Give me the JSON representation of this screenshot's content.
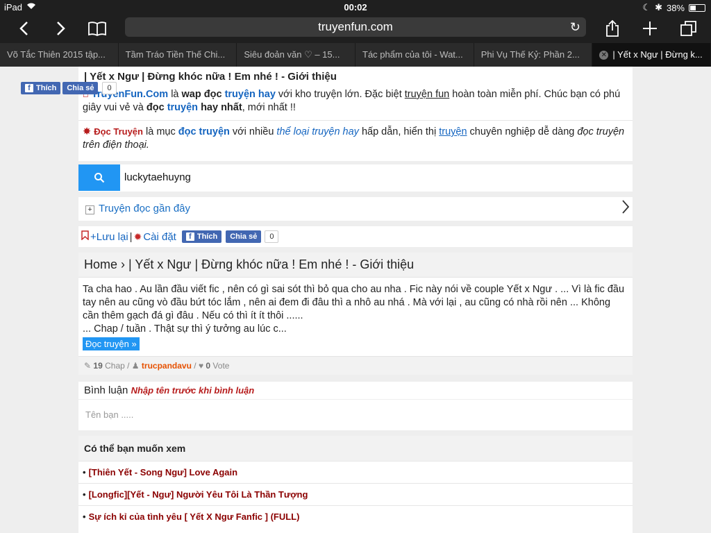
{
  "statusbar": {
    "device": "iPad",
    "time": "00:02",
    "battery": "38%",
    "battery_level": 0.38
  },
  "browser": {
    "url": "truyenfun.com",
    "tabs": [
      {
        "label": "Võ Tắc Thiên 2015 tập..."
      },
      {
        "label": "Tầm Tráo Tiền Thế Chi..."
      },
      {
        "label": "Siêu đoản văn ♡ – 15..."
      },
      {
        "label": "Tác phẩm của tôi - Wat..."
      },
      {
        "label": "Phi Vụ Thế Kỷ: Phần 2..."
      },
      {
        "label": "| Yết x Ngư | Đừng k..."
      }
    ]
  },
  "page": {
    "title": "| Yết x Ngư | Đừng khóc nữa ! Em nhé ! - Giới thiệu",
    "fb": {
      "like": "Thích",
      "share": "Chia sẻ",
      "count": "0"
    },
    "intro1": {
      "brand": "TruyenFun.Com",
      "t1": " là ",
      "b1": "wap đọc",
      "t2": " ",
      "l1": "truyện hay",
      "t3": " với kho truyện lớn. Đặc biệt ",
      "l2": "truyện fun",
      "t4": " hoàn toàn miễn phí. Chúc bạn có phú giây vui vẻ và ",
      "b2": "đọc",
      "t5": " ",
      "l3": "truyện",
      "t6": " ",
      "b3": "hay nhất",
      "t7": ", mới nhất !!"
    },
    "intro2": {
      "brand": "Đọc Truyện",
      "t1": " là mục ",
      "l1": "đọc truyện",
      "t2": " với nhiều ",
      "l2": "thể loại truyện hay",
      "t3": " hấp dẫn, hiển thị ",
      "l3": "truyện",
      "t4": " chuyên nghiệp dễ dàng ",
      "i1": "đọc truyện trên điện thoại."
    },
    "search": {
      "value": "luckytaehuyng"
    },
    "recent": "Truyện đọc gần đây",
    "actions": {
      "save": "+Lưu lại",
      "sep": "|",
      "settings": "Cài đặt"
    },
    "breadcrumb": {
      "home": "Home",
      "sep": " › ",
      "current": "| Yết x Ngư | Đừng khóc nữa ! Em nhé ! - Giới thiệu"
    },
    "description": "Ta cha hao . Au lần đầu viết fic , nên có gì sai sót thì bỏ qua cho au nha . Fic này nói về couple Yết x Ngư . ... Vì là fic đầu tay nên au cũng vò đầu bứt tóc lắm , nên ai đem đi đâu thì a nhô au nhá . Mà với lại , au cũng có nhà rồi nên ... Không cần thêm gạch đá gì đâu . Nếu có thì ít ít thôi ......",
    "description2": "... Chap / tuần . Thật sự thì ý tưởng au lúc c...",
    "read_button": "Đọc truyện »",
    "meta": {
      "chap_count": "19",
      "chap_label": " Chap / ",
      "author": "trucpandavu",
      "sep": " / ",
      "votes": "0",
      "vote_label": " Vote"
    },
    "comments": {
      "label": "Bình luận",
      "hint": "Nhập tên trước khi bình luận",
      "name_placeholder": "Tên bạn ....."
    },
    "recommend": {
      "heading": "Có thể bạn muốn xem",
      "items": [
        "[Thiên Yết - Song Ngư] Love Again",
        "[Longfic][Yết - Ngư] Người Yêu Tôi Là Thần Tượng",
        "Sự ích kỉ của tình yêu [ Yết X Ngư Fanfic ] (FULL)"
      ]
    }
  }
}
